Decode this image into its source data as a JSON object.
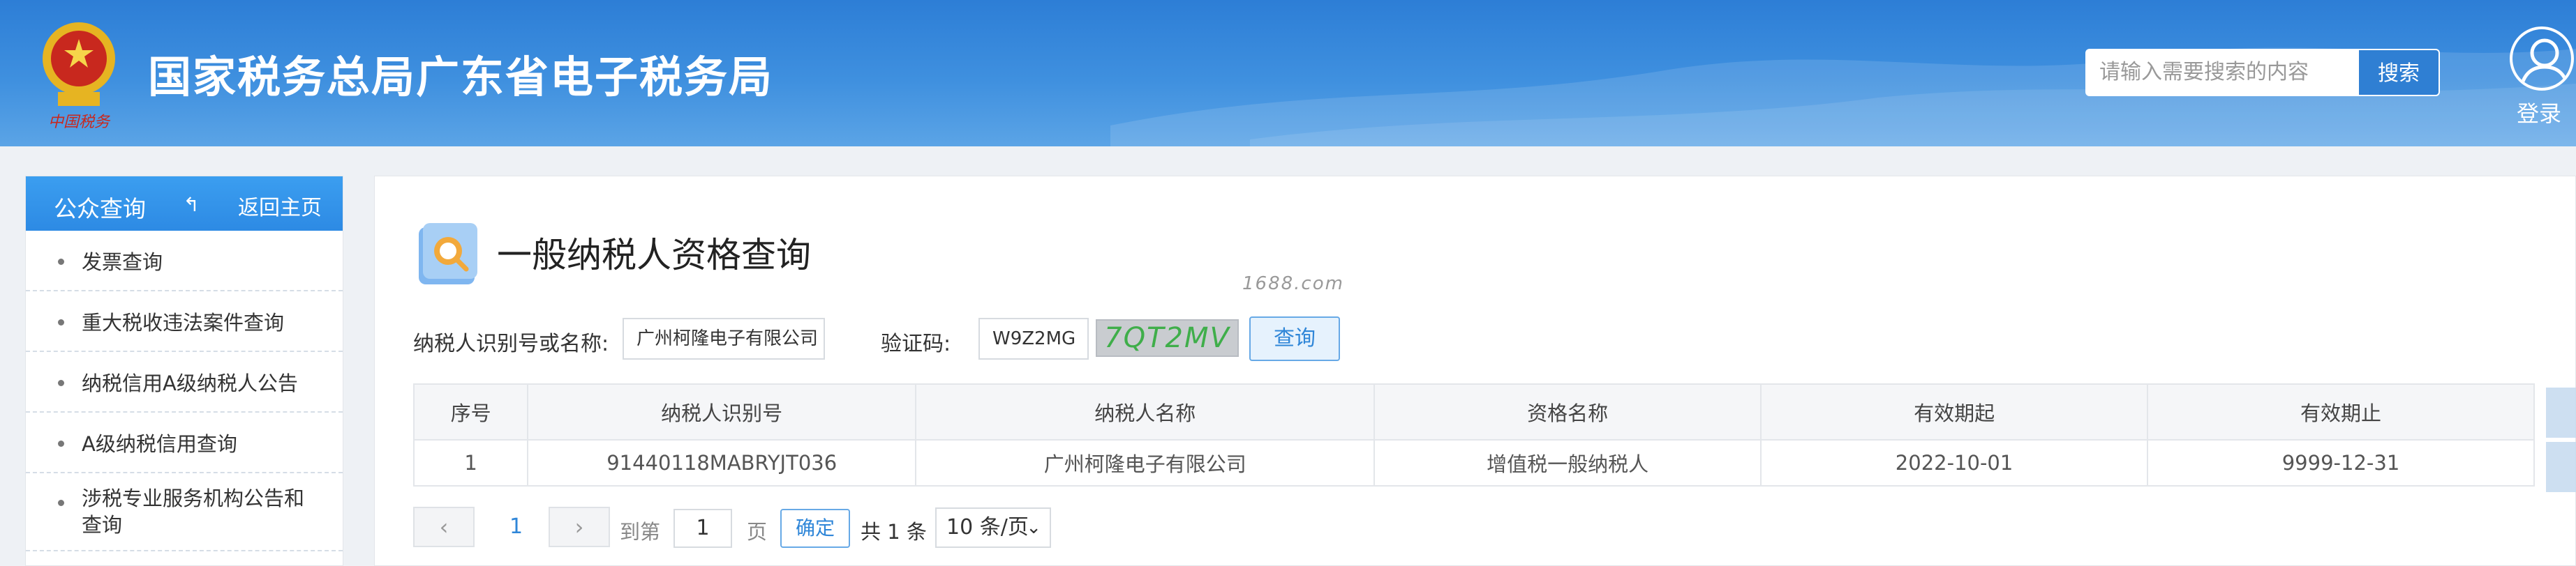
{
  "header": {
    "emblem_text": "中国税务",
    "site_title": "国家税务总局广东省电子税务局",
    "search_placeholder": "请输入需要搜索的内容",
    "search_button": "搜索",
    "login_label": "登录"
  },
  "sidebar": {
    "title": "公众查询",
    "back_label": "返回主页",
    "items": [
      {
        "label": "发票查询"
      },
      {
        "label": "重大税收违法案件查询"
      },
      {
        "label": "纳税信用A级纳税人公告"
      },
      {
        "label": "A级纳税信用查询"
      },
      {
        "label": "涉税专业服务机构公告和查询"
      }
    ]
  },
  "main": {
    "page_title": "一般纳税人资格查询",
    "watermark": "1688.com",
    "form": {
      "taxpayer_label": "纳税人识别号或名称:",
      "taxpayer_value": "广州柯隆电子有限公司",
      "captcha_label": "验证码:",
      "captcha_value": "W9Z2MG",
      "captcha_image_text": "7QT2MV",
      "query_button": "查询"
    },
    "table": {
      "columns": [
        "序号",
        "纳税人识别号",
        "纳税人名称",
        "资格名称",
        "有效期起",
        "有效期止"
      ],
      "rows": [
        [
          "1",
          "91440118MABRYJT036",
          "广州柯隆电子有限公司",
          "增值税一般纳税人",
          "2022-10-01",
          "9999-12-31"
        ]
      ]
    },
    "pagination": {
      "current_page": "1",
      "goto_label": "到第",
      "goto_value": "1",
      "page_unit": "页",
      "confirm_button": "确定",
      "total_text": "共 1 条",
      "page_size": "10 条/页"
    }
  },
  "colors": {
    "header_blue": "#2d7ed6",
    "accent_blue": "#2f86d8",
    "sidebar_head": "#3b9ef0"
  }
}
